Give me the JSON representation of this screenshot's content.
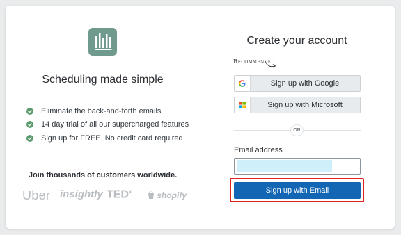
{
  "left_panel": {
    "tagline": "Scheduling made simple",
    "features": [
      "Eliminate the back-and-forth emails",
      "14 day trial of all our supercharged features",
      "Sign up for FREE. No credit card required"
    ],
    "join_text": "Join thousands of customers worldwide.",
    "customer_logos": {
      "uber": "Uber",
      "insightly": "insightly",
      "ted": "TED",
      "ted_sup": "x",
      "shopify": "shopify"
    }
  },
  "right_panel": {
    "title": "Create your account",
    "recommended_label": "Recommended",
    "google_button": "Sign up with Google",
    "microsoft_button": "Sign up with Microsoft",
    "separator": "OR",
    "email_label": "Email address",
    "email_button": "Sign up with Email"
  },
  "colors": {
    "brand_green": "#6f9a8d",
    "primary_blue": "#1366b3",
    "check_green": "#5b9a6c",
    "highlight_red": "#e02424"
  },
  "icons": {
    "logo": "app-logo-icon",
    "check": "check-circle-icon",
    "google": "google-icon",
    "microsoft": "microsoft-icon",
    "arrow": "curved-arrow-icon"
  }
}
